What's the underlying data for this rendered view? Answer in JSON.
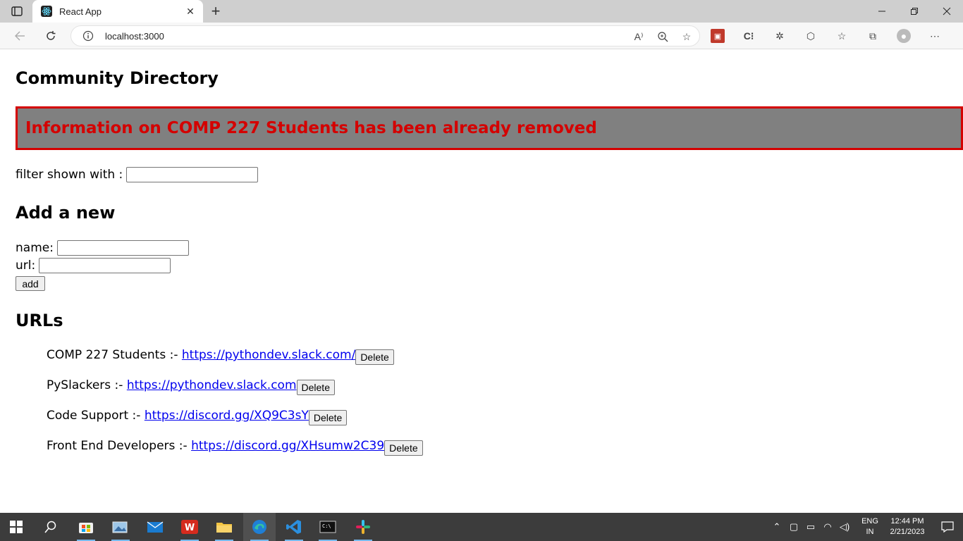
{
  "browser": {
    "tab_title": "React App",
    "address": "localhost:3000"
  },
  "page": {
    "title": "Community Directory",
    "error_message": "Information on COMP 227 Students has been already removed",
    "filter_label": "filter shown with :",
    "filter_value": "",
    "add_section_title": "Add a new",
    "name_label": "name:",
    "name_value": "",
    "url_label": "url:",
    "url_value": "",
    "add_button": "add",
    "urls_section_title": "URLs",
    "entries": [
      {
        "name_prefix": "COMP 227 Students :-",
        "url": "https://pythondev.slack.com/",
        "delete": "Delete"
      },
      {
        "name_prefix": "PySlackers :-",
        "url": "https://pythondev.slack.com",
        "delete": "Delete"
      },
      {
        "name_prefix": "Code Support :-",
        "url": "https://discord.gg/XQ9C3sY",
        "delete": "Delete"
      },
      {
        "name_prefix": "Front End Developers :-",
        "url": "https://discord.gg/XHsumw2C39",
        "delete": "Delete"
      }
    ]
  },
  "taskbar": {
    "lang_top": "ENG",
    "lang_bottom": "IN",
    "time": "12:44 PM",
    "date": "2/21/2023",
    "apps": [
      "start-icon",
      "search-icon",
      "store-icon",
      "photos-icon",
      "mail-icon",
      "wps-office-icon",
      "file-explorer-icon",
      "edge-icon",
      "vscode-icon",
      "terminal-icon",
      "slack-icon"
    ]
  },
  "colors": {
    "error_text": "#d40000",
    "error_bg": "#808080",
    "link": "#0000ee",
    "taskbar": "#3c3c3c"
  }
}
